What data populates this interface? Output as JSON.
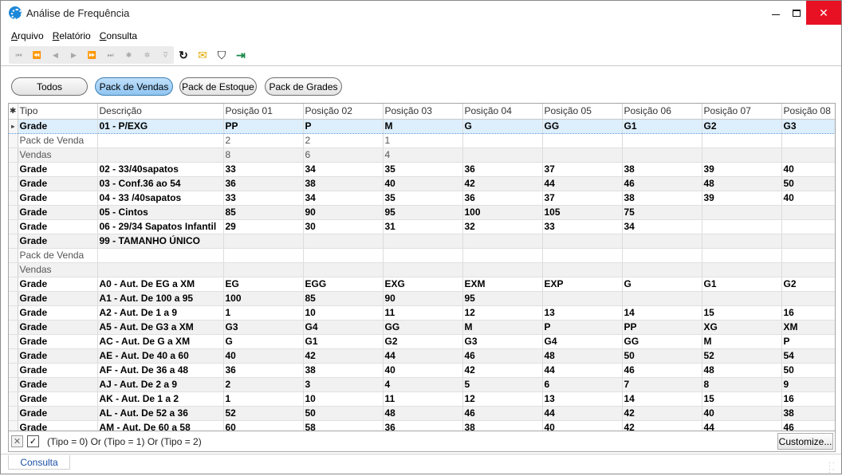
{
  "window": {
    "title": "Análise de Frequência",
    "minimize": "—",
    "maximize": "☐",
    "close": "✕"
  },
  "menu": [
    {
      "u": "A",
      "rest": "rquivo"
    },
    {
      "u": "R",
      "rest": "elatório"
    },
    {
      "u": "C",
      "rest": "onsulta"
    }
  ],
  "toolbar": {
    "nav": [
      "⏮",
      "⏪",
      "◀",
      "▶",
      "⏩",
      "⏭",
      "✱",
      "✲",
      "⩢"
    ],
    "refresh": "↻",
    "mail": "✉",
    "filter": "⛉",
    "exit": "⇥"
  },
  "pills": [
    "Todos",
    "Pack de Vendas",
    "Pack de Estoque",
    "Pack de Grades"
  ],
  "active_pill": "Pack de Vendas",
  "grid": {
    "indicator_header": "✱",
    "columns": [
      "Tipo",
      "Descrição",
      "Posição 01",
      "Posição 02",
      "Posição 03",
      "Posição 04",
      "Posição 05",
      "Posição 06",
      "Posição 07",
      "Posição 08"
    ],
    "rows": [
      {
        "kind": "grade",
        "sel": true,
        "cells": [
          "Grade",
          "01 - P/EXG",
          "PP",
          "P",
          "M",
          "G",
          "GG",
          "G1",
          "G2",
          "G3"
        ]
      },
      {
        "kind": "child",
        "cells": [
          "Pack de Venda",
          "",
          "2",
          "2",
          "1",
          "",
          "",
          "",
          "",
          ""
        ]
      },
      {
        "kind": "child",
        "cells": [
          "Vendas",
          "",
          "8",
          "6",
          "4",
          "",
          "",
          "",
          "",
          ""
        ]
      },
      {
        "kind": "grade",
        "cells": [
          "Grade",
          "02 - 33/40sapatos",
          "33",
          "34",
          "35",
          "36",
          "37",
          "38",
          "39",
          "40"
        ]
      },
      {
        "kind": "grade",
        "cells": [
          "Grade",
          "03 - Conf.36 ao 54",
          "36",
          "38",
          "40",
          "42",
          "44",
          "46",
          "48",
          "50"
        ]
      },
      {
        "kind": "grade",
        "cells": [
          "Grade",
          "04 - 33 /40sapatos",
          "33",
          "34",
          "35",
          "36",
          "37",
          "38",
          "39",
          "40"
        ]
      },
      {
        "kind": "grade",
        "cells": [
          "Grade",
          "05 - Cintos",
          "85",
          "90",
          "95",
          "100",
          "105",
          "75",
          "",
          ""
        ]
      },
      {
        "kind": "grade",
        "cells": [
          "Grade",
          "06 - 29/34 Sapatos Infantil",
          "29",
          "30",
          "31",
          "32",
          "33",
          "34",
          "",
          ""
        ]
      },
      {
        "kind": "grade",
        "cells": [
          "Grade",
          "99 - TAMANHO ÚNICO",
          "",
          "",
          "",
          "",
          "",
          "",
          "",
          ""
        ]
      },
      {
        "kind": "child",
        "cells": [
          "Pack de Venda",
          "",
          "",
          "",
          "",
          "",
          "",
          "",
          "",
          ""
        ]
      },
      {
        "kind": "child",
        "cells": [
          "Vendas",
          "",
          "",
          "",
          "",
          "",
          "",
          "",
          "",
          ""
        ]
      },
      {
        "kind": "grade",
        "cells": [
          "Grade",
          "A0 - Aut. De EG a XM",
          "EG",
          "EGG",
          "EXG",
          "EXM",
          "EXP",
          "G",
          "G1",
          "G2"
        ]
      },
      {
        "kind": "grade",
        "cells": [
          "Grade",
          "A1 - Aut. De 100 a 95",
          "100",
          "85",
          "90",
          "95",
          "",
          "",
          "",
          ""
        ]
      },
      {
        "kind": "grade",
        "cells": [
          "Grade",
          "A2 - Aut. De 1 a 9",
          "1",
          "10",
          "11",
          "12",
          "13",
          "14",
          "15",
          "16"
        ]
      },
      {
        "kind": "grade",
        "cells": [
          "Grade",
          "A5 - Aut. De G3 a XM",
          "G3",
          "G4",
          "GG",
          "M",
          "P",
          "PP",
          "XG",
          "XM"
        ]
      },
      {
        "kind": "grade",
        "cells": [
          "Grade",
          "AC - Aut. De G a XM",
          "G",
          "G1",
          "G2",
          "G3",
          "G4",
          "GG",
          "M",
          "P"
        ]
      },
      {
        "kind": "grade",
        "cells": [
          "Grade",
          "AE - Aut. De 40 a 60",
          "40",
          "42",
          "44",
          "46",
          "48",
          "50",
          "52",
          "54"
        ]
      },
      {
        "kind": "grade",
        "cells": [
          "Grade",
          "AF - Aut. De 36 a 48",
          "36",
          "38",
          "40",
          "42",
          "44",
          "46",
          "48",
          "50"
        ]
      },
      {
        "kind": "grade",
        "cells": [
          "Grade",
          "AJ - Aut. De 2 a 9",
          "2",
          "3",
          "4",
          "5",
          "6",
          "7",
          "8",
          "9"
        ]
      },
      {
        "kind": "grade",
        "cells": [
          "Grade",
          "AK - Aut. De 1 a 2",
          "1",
          "10",
          "11",
          "12",
          "13",
          "14",
          "15",
          "16"
        ]
      },
      {
        "kind": "grade",
        "cells": [
          "Grade",
          "AL - Aut. De 52 a 36",
          "52",
          "50",
          "48",
          "46",
          "44",
          "42",
          "40",
          "38"
        ]
      },
      {
        "kind": "grade",
        "cells": [
          "Grade",
          "AM - Aut. De 60 a 58",
          "60",
          "58",
          "36",
          "38",
          "40",
          "42",
          "44",
          "46"
        ]
      }
    ]
  },
  "filterbar": {
    "x": "✕",
    "check": "✓",
    "expression": "(Tipo = 0) Or (Tipo = 1) Or (Tipo = 2)",
    "customize": "Customize..."
  },
  "bottom_tab": "Consulta",
  "row_indicator": "▸"
}
